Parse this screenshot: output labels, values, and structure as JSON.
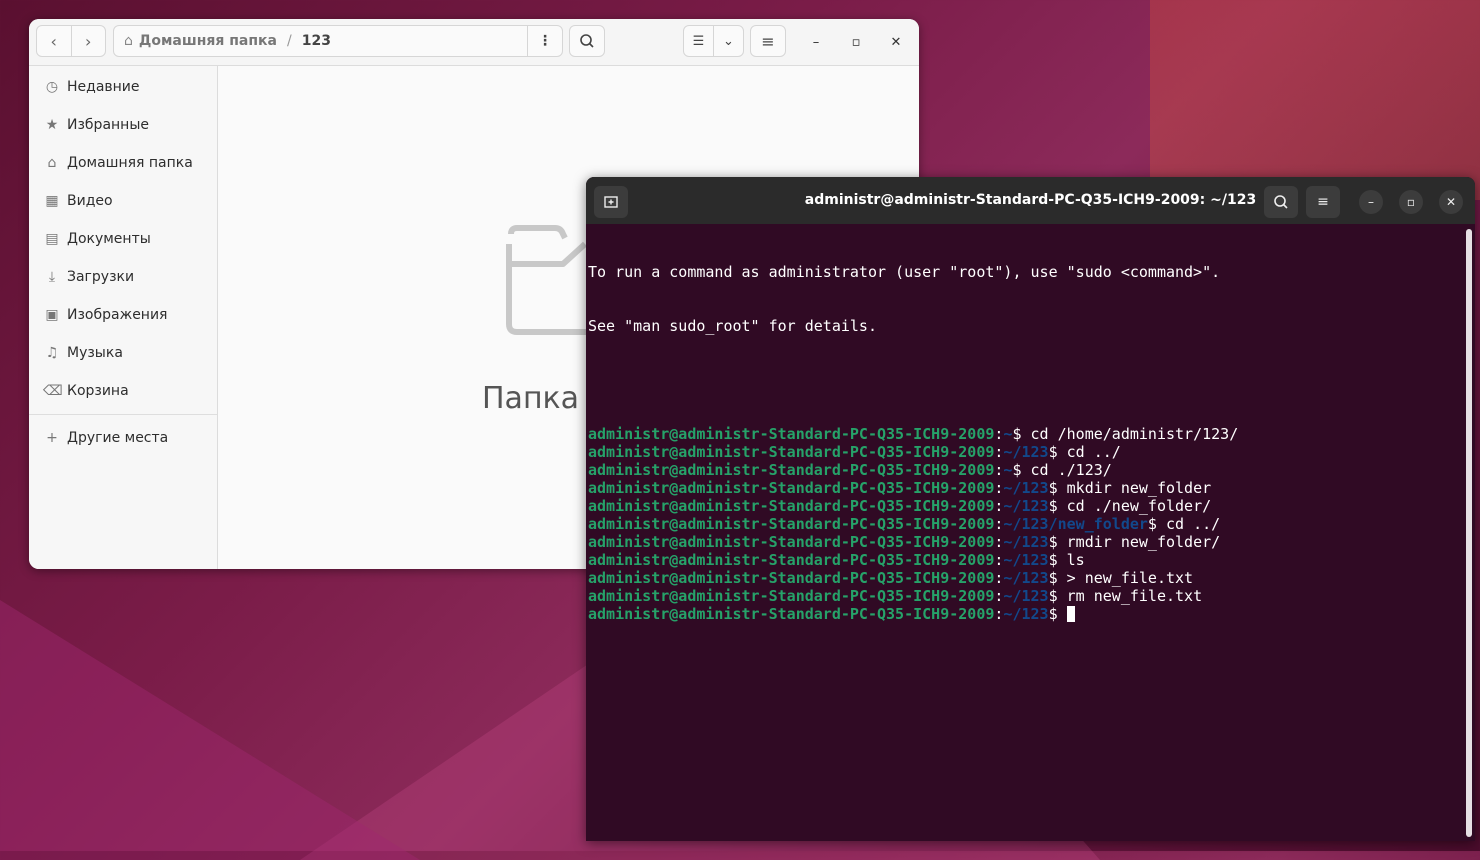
{
  "file_manager": {
    "path": [
      "Домашняя папка",
      "123"
    ],
    "path_separator": "/",
    "sidebar": [
      {
        "label": "Недавние",
        "icon": "clock-icon"
      },
      {
        "label": "Избранные",
        "icon": "star-icon"
      },
      {
        "label": "Домашняя папка",
        "icon": "home-icon"
      },
      {
        "label": "Видео",
        "icon": "video-icon"
      },
      {
        "label": "Документы",
        "icon": "document-icon"
      },
      {
        "label": "Загрузки",
        "icon": "download-icon"
      },
      {
        "label": "Изображения",
        "icon": "image-icon"
      },
      {
        "label": "Музыка",
        "icon": "music-icon"
      },
      {
        "label": "Корзина",
        "icon": "trash-icon"
      }
    ],
    "other_places": "Другие места",
    "empty_text": "Папка пуста"
  },
  "terminal": {
    "title": "administr@administr-Standard-PC-Q35-ICH9-2009: ~/123",
    "intro": [
      "To run a command as administrator (user \"root\"), use \"sudo <command>\".",
      "See \"man sudo_root\" for details."
    ],
    "prompt_user": "administr@administr-Standard-PC-Q35-ICH9-2009",
    "lines": [
      {
        "path": "~",
        "cmd": "cd /home/administr/123/"
      },
      {
        "path": "~/123",
        "cmd": "cd ../"
      },
      {
        "path": "~",
        "cmd": "cd ./123/"
      },
      {
        "path": "~/123",
        "cmd": "mkdir new_folder"
      },
      {
        "path": "~/123",
        "cmd": "cd ./new_folder/"
      },
      {
        "path": "~/123/new_folder",
        "cmd": "cd ../"
      },
      {
        "path": "~/123",
        "cmd": "rmdir new_folder/"
      },
      {
        "path": "~/123",
        "cmd": "ls"
      },
      {
        "path": "~/123",
        "cmd": "> new_file.txt"
      },
      {
        "path": "~/123",
        "cmd": "rm new_file.txt"
      },
      {
        "path": "~/123",
        "cmd": ""
      }
    ]
  },
  "colors": {
    "terminal_bg": "#300a24",
    "prompt_user": "#26a269",
    "prompt_path": "#12488b"
  }
}
